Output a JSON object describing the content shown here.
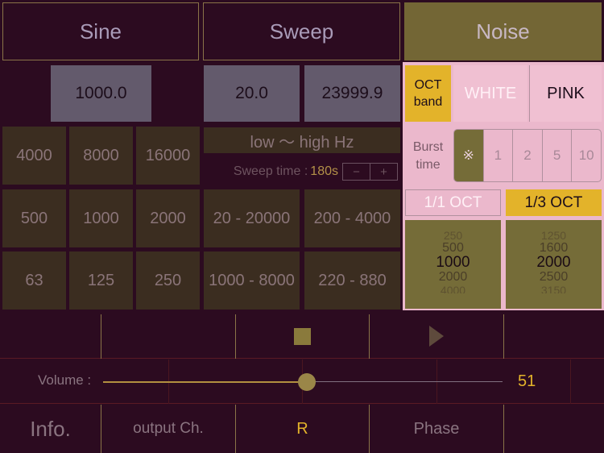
{
  "modes": {
    "sine": "Sine",
    "sweep": "Sweep",
    "noise": "Noise"
  },
  "sine": {
    "frequency": "1000.0",
    "presets": [
      [
        "4000",
        "8000",
        "16000"
      ],
      [
        "500",
        "1000",
        "2000"
      ],
      [
        "63",
        "125",
        "250"
      ]
    ]
  },
  "sweep": {
    "start": "20.0",
    "end": "23999.9",
    "direction": "low 〜 high Hz",
    "time_label": "Sweep time :",
    "time_value": "180s",
    "minus": "−",
    "plus": "+",
    "presets": [
      [
        "20 - 20000",
        "200 - 4000"
      ],
      [
        "1000 - 8000",
        "220 - 880"
      ]
    ]
  },
  "noise": {
    "oct_band": "OCT band",
    "white": "WHITE",
    "pink": "PINK",
    "burst_time": "Burst time",
    "burst_options": [
      "※",
      "1",
      "2",
      "5",
      "10"
    ],
    "full_oct": "1/1 OCT",
    "third_oct": "1/3 OCT",
    "picker_left": [
      "250",
      "500",
      "1000",
      "2000",
      "4000"
    ],
    "picker_right": [
      "1250",
      "1600",
      "2000",
      "2500",
      "3150"
    ]
  },
  "transport": {
    "stop_icon": "stop-icon",
    "play_icon": "play-icon"
  },
  "volume": {
    "label": "Volume :",
    "value": "51",
    "level": 0.51
  },
  "bottom": {
    "info": "Info.",
    "output": "output Ch.",
    "channel": "R",
    "phase": "Phase"
  },
  "colors": {
    "background": "#2c0b20",
    "accent_gold": "#e3b32a",
    "pink_panel": "#ebb8cc",
    "olive": "#736635"
  }
}
